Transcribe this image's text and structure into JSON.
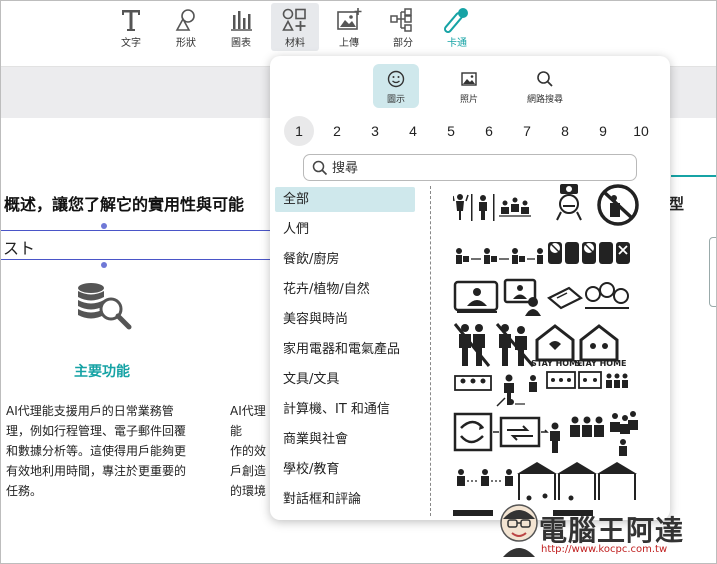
{
  "toolbar": {
    "tools": [
      {
        "label": "文字",
        "icon": "text-icon"
      },
      {
        "label": "形狀",
        "icon": "shapes-icon"
      },
      {
        "label": "圖表",
        "icon": "chart-icon"
      },
      {
        "label": "材料",
        "icon": "materials-icon",
        "active": true
      },
      {
        "label": "上傳",
        "icon": "upload-image-icon"
      },
      {
        "label": "部分",
        "icon": "sections-icon"
      },
      {
        "label": "卡通",
        "icon": "cartoon-icon"
      }
    ]
  },
  "document": {
    "heading": "概述，讓您了解它的實用性與可能",
    "heading_right": "型",
    "textbox": "スト",
    "feature_title": "主要功能",
    "paragraph_left": [
      "AI代理能支援用戶的日常業務管",
      "理，例如行程管理、電子郵件回覆",
      "和數據分析等。這使得用戶能夠更",
      "有效地利用時間，專注於更重要的",
      "任務。"
    ],
    "paragraph_mid": [
      "AI代理能",
      "作的效",
      "戶創造",
      "的環境"
    ]
  },
  "panel": {
    "tabs": [
      {
        "label": "圖示",
        "icon": "smiley-icon",
        "active": true
      },
      {
        "label": "照片",
        "icon": "photo-icon"
      },
      {
        "label": "網路搜尋",
        "icon": "search-icon"
      }
    ],
    "pages": [
      "1",
      "2",
      "3",
      "4",
      "5",
      "6",
      "7",
      "8",
      "9",
      "10"
    ],
    "active_page": "1",
    "search_placeholder": "搜尋",
    "categories": [
      "全部",
      "人們",
      "餐飲/廚房",
      "花卉/植物/自然",
      "美容與時尚",
      "家用電器和電氣產品",
      "文具/文具",
      "計算機、IT 和通信",
      "商業與社會",
      "學校/教育",
      "對話框和評論"
    ],
    "active_category": "全部",
    "gallery_labels": [
      "STAY HOME",
      "STAY HOME"
    ]
  },
  "watermark": {
    "text": "電腦王阿達",
    "url": "http://www.kocpc.com.tw"
  },
  "colors": {
    "accent": "#16a3a5",
    "selection": "#4a55c8",
    "tab_active": "#cfe8ec"
  }
}
